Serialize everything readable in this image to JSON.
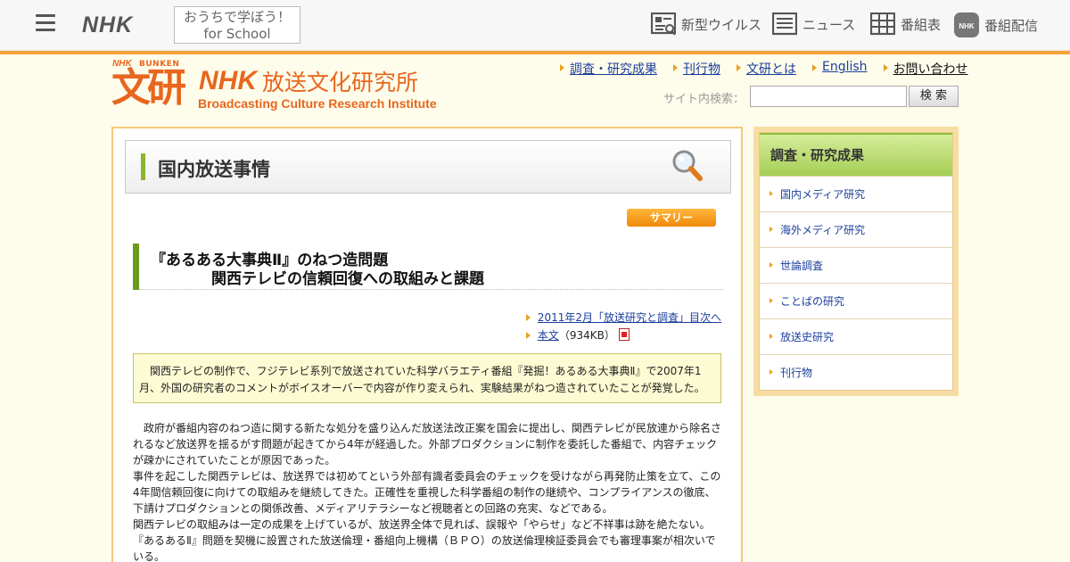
{
  "global_nav": {
    "brand": "NHK",
    "school_line1": "おうちで学ぼう！",
    "school_line2": "for School",
    "items": [
      {
        "label": "新型ウイルス",
        "icon": "virus-news-icon"
      },
      {
        "label": "ニュース",
        "icon": "news-icon"
      },
      {
        "label": "番組表",
        "icon": "program-guide-icon"
      },
      {
        "label": "番組配信",
        "icon": "nhk-plus-icon"
      }
    ]
  },
  "institute": {
    "logo_small": "NHK",
    "logo_bunken": "BUNKEN",
    "logo_kanji": "文研",
    "name_nhk": "NHK",
    "name_jp": "放送文化研究所",
    "name_en": "Broadcasting Culture Research Institute"
  },
  "top_links": [
    "調査・研究成果",
    "刊行物",
    "文研とは",
    "English",
    "お問い合わせ"
  ],
  "search": {
    "label": "サイト内検索：",
    "button": "検 索"
  },
  "section": {
    "title": "国内放送事情",
    "badge": "サマリー"
  },
  "article": {
    "title_line1": "『あるある大事典Ⅱ』のねつ造問題",
    "title_line2": "関西テレビの信頼回復への取組みと課題",
    "issue_link": "2011年2月「放送研究と調査」目次へ",
    "body_link": "本文",
    "body_size": "（934KB）",
    "abstract": "関西テレビの制作で、フジテレビ系列で放送されていた科学バラエティ番組『発掘！あるある大事典Ⅱ』で2007年1月、外国の研究者のコメントがボイスオーバーで内容が作り変えられ、実験結果がねつ造されていたことが発覚した。",
    "paragraphs": [
      "政府が番組内容のねつ造に関する新たな処分を盛り込んだ放送法改正案を国会に提出し、関西テレビが民放連から除名されるなど放送界を揺るがす問題が起きてから4年が経過した。外部プロダクションに制作を委託した番組で、内容チェックが疎かにされていたことが原因であった。",
      "事件を起こした関西テレビは、放送界では初めてという外部有識者委員会のチェックを受けながら再発防止策を立て、この4年間信頼回復に向けての取組みを継続してきた。正確性を重視した科学番組の制作の継続や、コンプライアンスの徹底、下請けプロダクションとの関係改善、メディアリテラシーなど視聴者との回路の充実、などである。",
      "関西テレビの取組みは一定の成果を上げているが、放送界全体で見れば、誤報や「やらせ」など不祥事は跡を絶たない。『あるあるⅡ』問題を契機に設置された放送倫理・番組向上機構（ＢＰＯ）の放送倫理検証委員会でも審理事案が相次いでいる。"
    ]
  },
  "sidebar": {
    "title": "調査・研究成果",
    "items": [
      "国内メディア研究",
      "海外メディア研究",
      "世論調査",
      "ことばの研究",
      "放送史研究",
      "刊行物"
    ]
  },
  "colors": {
    "accent_orange": "#e8661e",
    "link_blue": "#1a3e9c",
    "green_bar": "#8cb42c",
    "badge_orange": "#f5a337",
    "page_bg": "#fefcea"
  }
}
